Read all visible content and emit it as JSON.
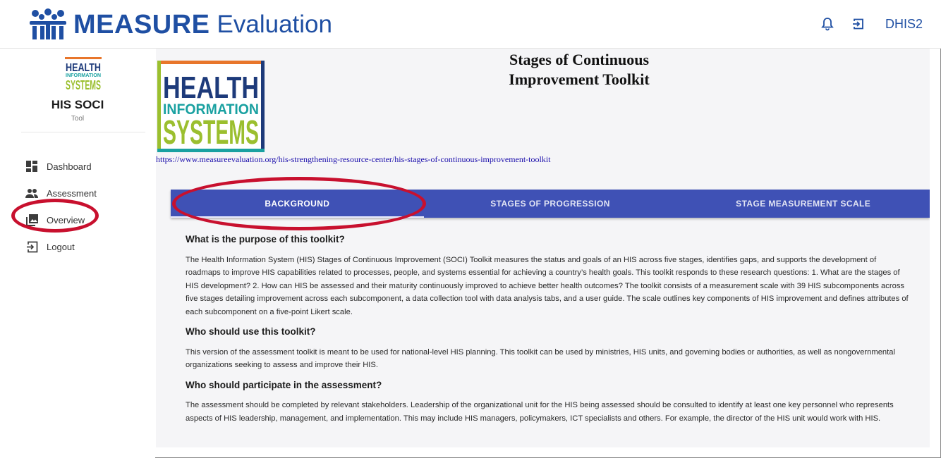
{
  "header": {
    "brand_bold": "MEASURE",
    "brand_light": "Evaluation",
    "right_label": "DHIS2",
    "icons": [
      "bell-icon",
      "login-icon"
    ]
  },
  "sidebar": {
    "logo_lines": [
      "HEALTH",
      "INFORMATION",
      "SYSTEMS"
    ],
    "app_title": "HIS SOCI",
    "app_subtitle": "Tool",
    "items": [
      {
        "label": "Dashboard",
        "icon": "dashboard-icon"
      },
      {
        "label": "Assessment",
        "icon": "people-icon"
      },
      {
        "label": "Overview",
        "icon": "photo-library-icon"
      },
      {
        "label": "Logout",
        "icon": "logout-icon"
      }
    ]
  },
  "main": {
    "logo_lines": [
      "HEALTH",
      "INFORMATION",
      "SYSTEMS"
    ],
    "title_line1": "Stages of Continuous",
    "title_line2": "Improvement Toolkit",
    "url": "https://www.measureevaluation.org/his-strengthening-resource-center/his-stages-of-continuous-improvement-toolkit",
    "tabs": [
      {
        "label": "BACKGROUND",
        "active": true
      },
      {
        "label": "STAGES OF PROGRESSION",
        "active": false
      },
      {
        "label": "STAGE MEASUREMENT SCALE",
        "active": false
      }
    ],
    "sections": [
      {
        "heading": "What is the purpose of this toolkit?",
        "body": "The Health Information System (HIS) Stages of Continuous Improvement (SOCI) Toolkit measures the status and goals of an HIS across five stages, identifies gaps, and supports the development of roadmaps to improve HIS capabilities related to processes, people, and systems essential for achieving a country’s health goals. This toolkit responds to these research questions: 1. What are the stages of HIS development? 2. How can HIS be assessed and their maturity continuously improved to achieve better health outcomes? The toolkit consists of a measurement scale with 39 HIS subcomponents across five stages detailing improvement across each subcomponent, a data collection tool with data analysis tabs, and a user guide. The scale outlines key components of HIS improvement and defines attributes of each subcomponent on a five-point Likert scale."
      },
      {
        "heading": "Who should use this toolkit?",
        "body": "This version of the assessment toolkit is meant to be used for national-level HIS planning. This toolkit can be used by ministries, HIS units, and governing bodies or authorities, as well as nongovernmental organizations seeking to assess and improve their HIS."
      },
      {
        "heading": "Who should participate in the assessment?",
        "body": "The assessment should be completed by relevant stakeholders. Leadership of the organizational unit for the HIS being assessed should be consulted to identify at least one key personnel who represents aspects of HIS leadership, management, and implementation. This may include HIS managers, policymakers, ICT specialists and others. For example, the director of the HIS unit would work with HIS."
      }
    ]
  },
  "colors": {
    "brand_blue": "#1f4fa3",
    "tab_bar": "#3f51b5",
    "annotation_red": "#c8102e",
    "logo_orange": "#e8762b",
    "logo_green": "#9bbf2f",
    "logo_teal": "#1aa1a1",
    "logo_navy": "#1d3a7a"
  }
}
